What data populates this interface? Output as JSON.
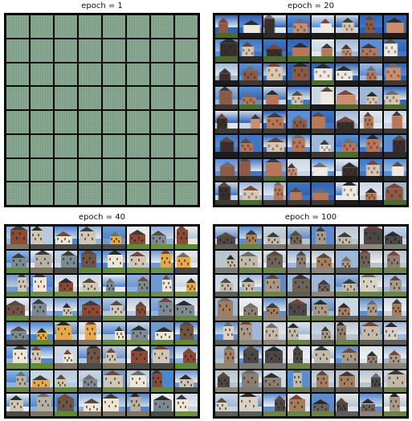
{
  "panels": [
    {
      "title": "epoch = 1",
      "style": "noise"
    },
    {
      "title": "epoch = 20",
      "style": "blurry"
    },
    {
      "title": "epoch = 40",
      "style": "houses"
    },
    {
      "title": "epoch = 100",
      "style": "detailed"
    }
  ],
  "grid": {
    "rows": 8,
    "cols": 8
  },
  "colors": {
    "noise": "#80a48a",
    "sky_blue": "#3f77c4",
    "sky_pale": "#c9d6e4",
    "grass": "#5f8a3a",
    "brick": "#8a4a34",
    "stone": "#a89a86",
    "dark": "#2a2a2a"
  }
}
